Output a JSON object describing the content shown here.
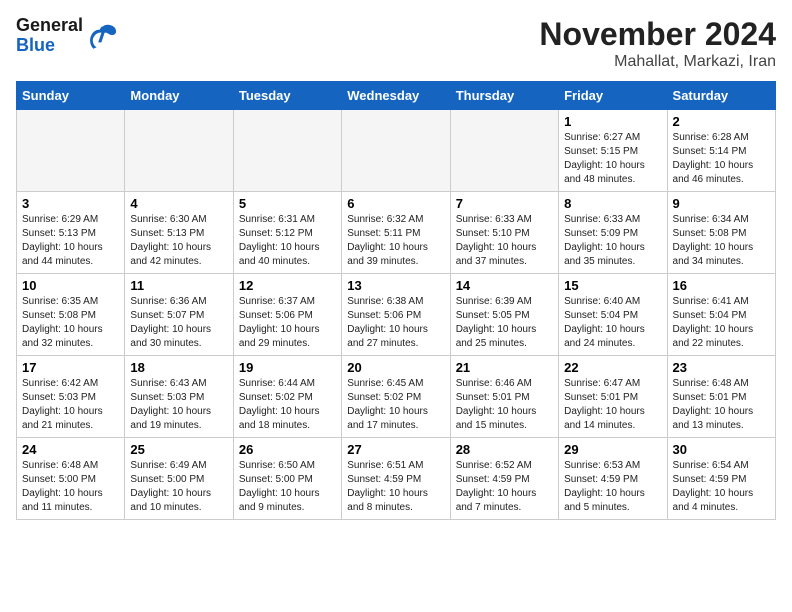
{
  "header": {
    "logo_general": "General",
    "logo_blue": "Blue",
    "title": "November 2024",
    "location": "Mahallat, Markazi, Iran"
  },
  "weekdays": [
    "Sunday",
    "Monday",
    "Tuesday",
    "Wednesday",
    "Thursday",
    "Friday",
    "Saturday"
  ],
  "weeks": [
    [
      {
        "day": "",
        "empty": true
      },
      {
        "day": "",
        "empty": true
      },
      {
        "day": "",
        "empty": true
      },
      {
        "day": "",
        "empty": true
      },
      {
        "day": "",
        "empty": true
      },
      {
        "day": "1",
        "sunrise": "6:27 AM",
        "sunset": "5:15 PM",
        "daylight": "10 hours and 48 minutes."
      },
      {
        "day": "2",
        "sunrise": "6:28 AM",
        "sunset": "5:14 PM",
        "daylight": "10 hours and 46 minutes."
      }
    ],
    [
      {
        "day": "3",
        "sunrise": "6:29 AM",
        "sunset": "5:13 PM",
        "daylight": "10 hours and 44 minutes."
      },
      {
        "day": "4",
        "sunrise": "6:30 AM",
        "sunset": "5:13 PM",
        "daylight": "10 hours and 42 minutes."
      },
      {
        "day": "5",
        "sunrise": "6:31 AM",
        "sunset": "5:12 PM",
        "daylight": "10 hours and 40 minutes."
      },
      {
        "day": "6",
        "sunrise": "6:32 AM",
        "sunset": "5:11 PM",
        "daylight": "10 hours and 39 minutes."
      },
      {
        "day": "7",
        "sunrise": "6:33 AM",
        "sunset": "5:10 PM",
        "daylight": "10 hours and 37 minutes."
      },
      {
        "day": "8",
        "sunrise": "6:33 AM",
        "sunset": "5:09 PM",
        "daylight": "10 hours and 35 minutes."
      },
      {
        "day": "9",
        "sunrise": "6:34 AM",
        "sunset": "5:08 PM",
        "daylight": "10 hours and 34 minutes."
      }
    ],
    [
      {
        "day": "10",
        "sunrise": "6:35 AM",
        "sunset": "5:08 PM",
        "daylight": "10 hours and 32 minutes."
      },
      {
        "day": "11",
        "sunrise": "6:36 AM",
        "sunset": "5:07 PM",
        "daylight": "10 hours and 30 minutes."
      },
      {
        "day": "12",
        "sunrise": "6:37 AM",
        "sunset": "5:06 PM",
        "daylight": "10 hours and 29 minutes."
      },
      {
        "day": "13",
        "sunrise": "6:38 AM",
        "sunset": "5:06 PM",
        "daylight": "10 hours and 27 minutes."
      },
      {
        "day": "14",
        "sunrise": "6:39 AM",
        "sunset": "5:05 PM",
        "daylight": "10 hours and 25 minutes."
      },
      {
        "day": "15",
        "sunrise": "6:40 AM",
        "sunset": "5:04 PM",
        "daylight": "10 hours and 24 minutes."
      },
      {
        "day": "16",
        "sunrise": "6:41 AM",
        "sunset": "5:04 PM",
        "daylight": "10 hours and 22 minutes."
      }
    ],
    [
      {
        "day": "17",
        "sunrise": "6:42 AM",
        "sunset": "5:03 PM",
        "daylight": "10 hours and 21 minutes."
      },
      {
        "day": "18",
        "sunrise": "6:43 AM",
        "sunset": "5:03 PM",
        "daylight": "10 hours and 19 minutes."
      },
      {
        "day": "19",
        "sunrise": "6:44 AM",
        "sunset": "5:02 PM",
        "daylight": "10 hours and 18 minutes."
      },
      {
        "day": "20",
        "sunrise": "6:45 AM",
        "sunset": "5:02 PM",
        "daylight": "10 hours and 17 minutes."
      },
      {
        "day": "21",
        "sunrise": "6:46 AM",
        "sunset": "5:01 PM",
        "daylight": "10 hours and 15 minutes."
      },
      {
        "day": "22",
        "sunrise": "6:47 AM",
        "sunset": "5:01 PM",
        "daylight": "10 hours and 14 minutes."
      },
      {
        "day": "23",
        "sunrise": "6:48 AM",
        "sunset": "5:01 PM",
        "daylight": "10 hours and 13 minutes."
      }
    ],
    [
      {
        "day": "24",
        "sunrise": "6:48 AM",
        "sunset": "5:00 PM",
        "daylight": "10 hours and 11 minutes."
      },
      {
        "day": "25",
        "sunrise": "6:49 AM",
        "sunset": "5:00 PM",
        "daylight": "10 hours and 10 minutes."
      },
      {
        "day": "26",
        "sunrise": "6:50 AM",
        "sunset": "5:00 PM",
        "daylight": "10 hours and 9 minutes."
      },
      {
        "day": "27",
        "sunrise": "6:51 AM",
        "sunset": "4:59 PM",
        "daylight": "10 hours and 8 minutes."
      },
      {
        "day": "28",
        "sunrise": "6:52 AM",
        "sunset": "4:59 PM",
        "daylight": "10 hours and 7 minutes."
      },
      {
        "day": "29",
        "sunrise": "6:53 AM",
        "sunset": "4:59 PM",
        "daylight": "10 hours and 5 minutes."
      },
      {
        "day": "30",
        "sunrise": "6:54 AM",
        "sunset": "4:59 PM",
        "daylight": "10 hours and 4 minutes."
      }
    ]
  ]
}
